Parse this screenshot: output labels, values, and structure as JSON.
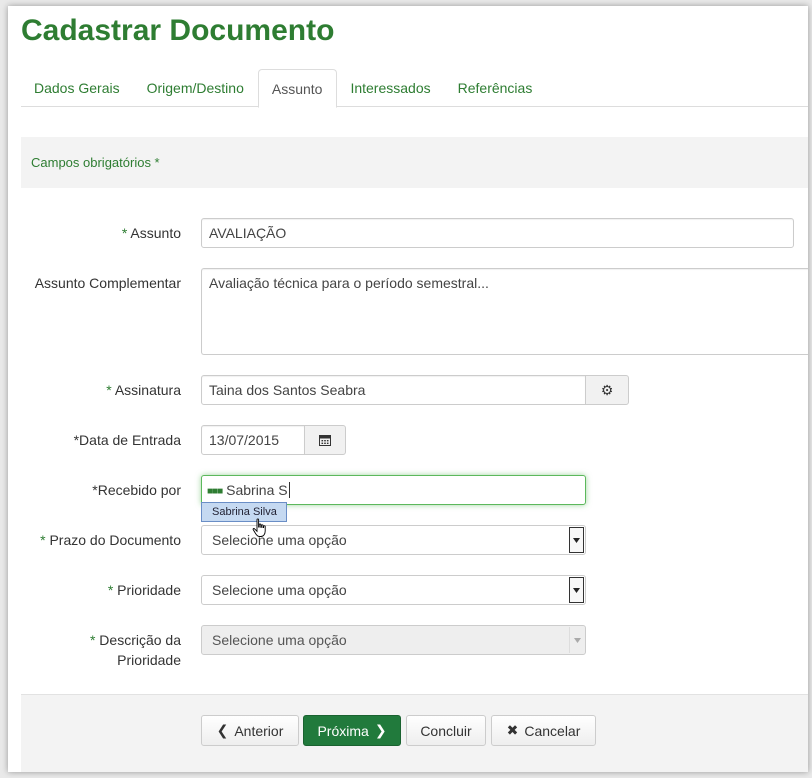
{
  "page_title": "Cadastrar Documento",
  "tabs": [
    {
      "label": "Dados Gerais"
    },
    {
      "label": "Origem/Destino"
    },
    {
      "label": "Assunto"
    },
    {
      "label": "Interessados"
    },
    {
      "label": "Referências"
    }
  ],
  "active_tab": "Assunto",
  "required_note": "Campos obrigatórios *",
  "form": {
    "assunto": {
      "label": "Assunto",
      "value": "AVALIAÇÃO"
    },
    "assunto_complementar": {
      "label": "Assunto Complementar",
      "value": "Avaliação técnica para o período semestral..."
    },
    "assinatura": {
      "label": "Assinatura",
      "value": "Taina dos Santos Seabra"
    },
    "data_entrada": {
      "label": "*Data de Entrada",
      "value": "13/07/2015"
    },
    "recebido_por": {
      "label": "*Recebido por",
      "value": "Sabrina S",
      "suggestion": "Sabrina Silva"
    },
    "prazo": {
      "label": "Prazo do Documento",
      "value": "Selecione uma opção"
    },
    "prioridade": {
      "label": "Prioridade",
      "value": "Selecione uma opção"
    },
    "descricao_prioridade": {
      "label_line1": "Descrição da",
      "label_line2": "Prioridade",
      "value": "Selecione uma opção"
    }
  },
  "buttons": {
    "anterior": "Anterior",
    "proxima": "Próxima",
    "concluir": "Concluir",
    "cancelar": "Cancelar"
  },
  "colors": {
    "brand_green": "#2e7d32",
    "primary_button": "#217a3c"
  }
}
